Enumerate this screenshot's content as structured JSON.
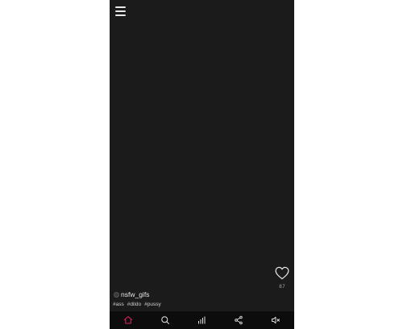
{
  "app": {
    "colors": {
      "background": "#1b1b1b",
      "nav_background": "#0c0c0c",
      "accent": "#e0245e",
      "icon": "#e6e6e6"
    }
  },
  "header": {
    "menu_icon": "hamburger-menu-icon"
  },
  "post": {
    "author": "nsfw_gifs",
    "likes": "87",
    "tags": [
      "#ass",
      "#dildo",
      "#pussy"
    ]
  },
  "bottom_nav": {
    "items": [
      {
        "icon": "home-icon",
        "active": true
      },
      {
        "icon": "search-icon",
        "active": false
      },
      {
        "icon": "chart-icon",
        "active": false
      },
      {
        "icon": "share-icon",
        "active": false
      },
      {
        "icon": "volume-mute-icon",
        "active": false
      }
    ]
  }
}
